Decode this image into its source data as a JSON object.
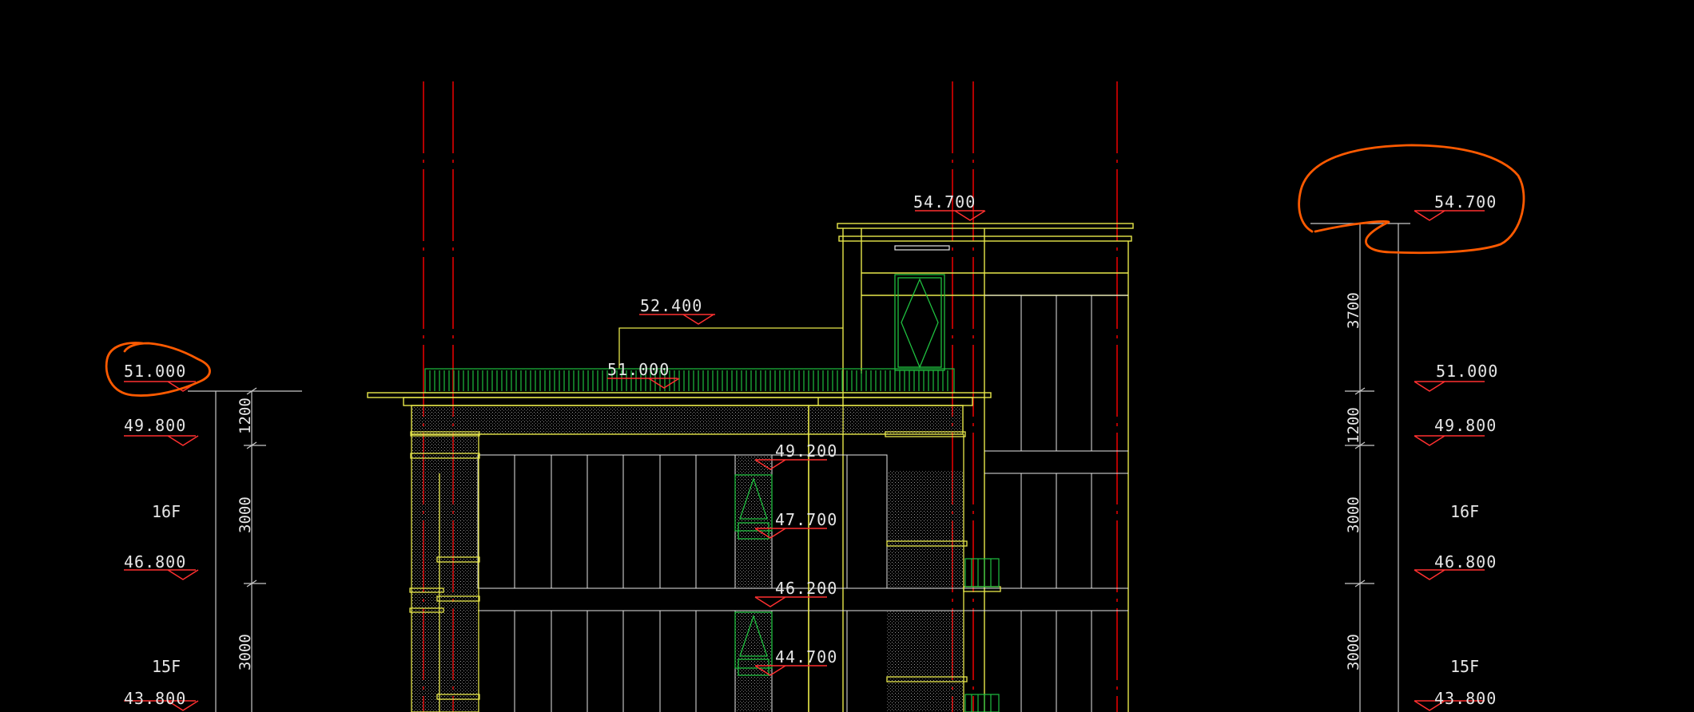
{
  "drawing": {
    "colors": {
      "background": "#000000",
      "outline": "#e8e84a",
      "axis": "#e00000",
      "railing": "#1fbf3f",
      "marker": "#ff3030",
      "text": "#e6e6e6",
      "dimension": "#c8c8c8",
      "annotation": "#ff5a00"
    },
    "left_elevations": [
      "51.000",
      "49.800",
      "46.800",
      "43.800"
    ],
    "left_floors": [
      "16F",
      "15F"
    ],
    "left_dimensions": [
      "1200",
      "3000",
      "3000"
    ],
    "right_elevations": [
      "54.700",
      "51.000",
      "49.800",
      "46.800",
      "43.800"
    ],
    "right_floors": [
      "16F",
      "15F"
    ],
    "right_dimensions": [
      "3700",
      "1200",
      "3000",
      "3000"
    ],
    "building_elevations": [
      "54.700",
      "52.400",
      "51.000",
      "49.200",
      "47.700",
      "46.200",
      "44.700"
    ]
  }
}
